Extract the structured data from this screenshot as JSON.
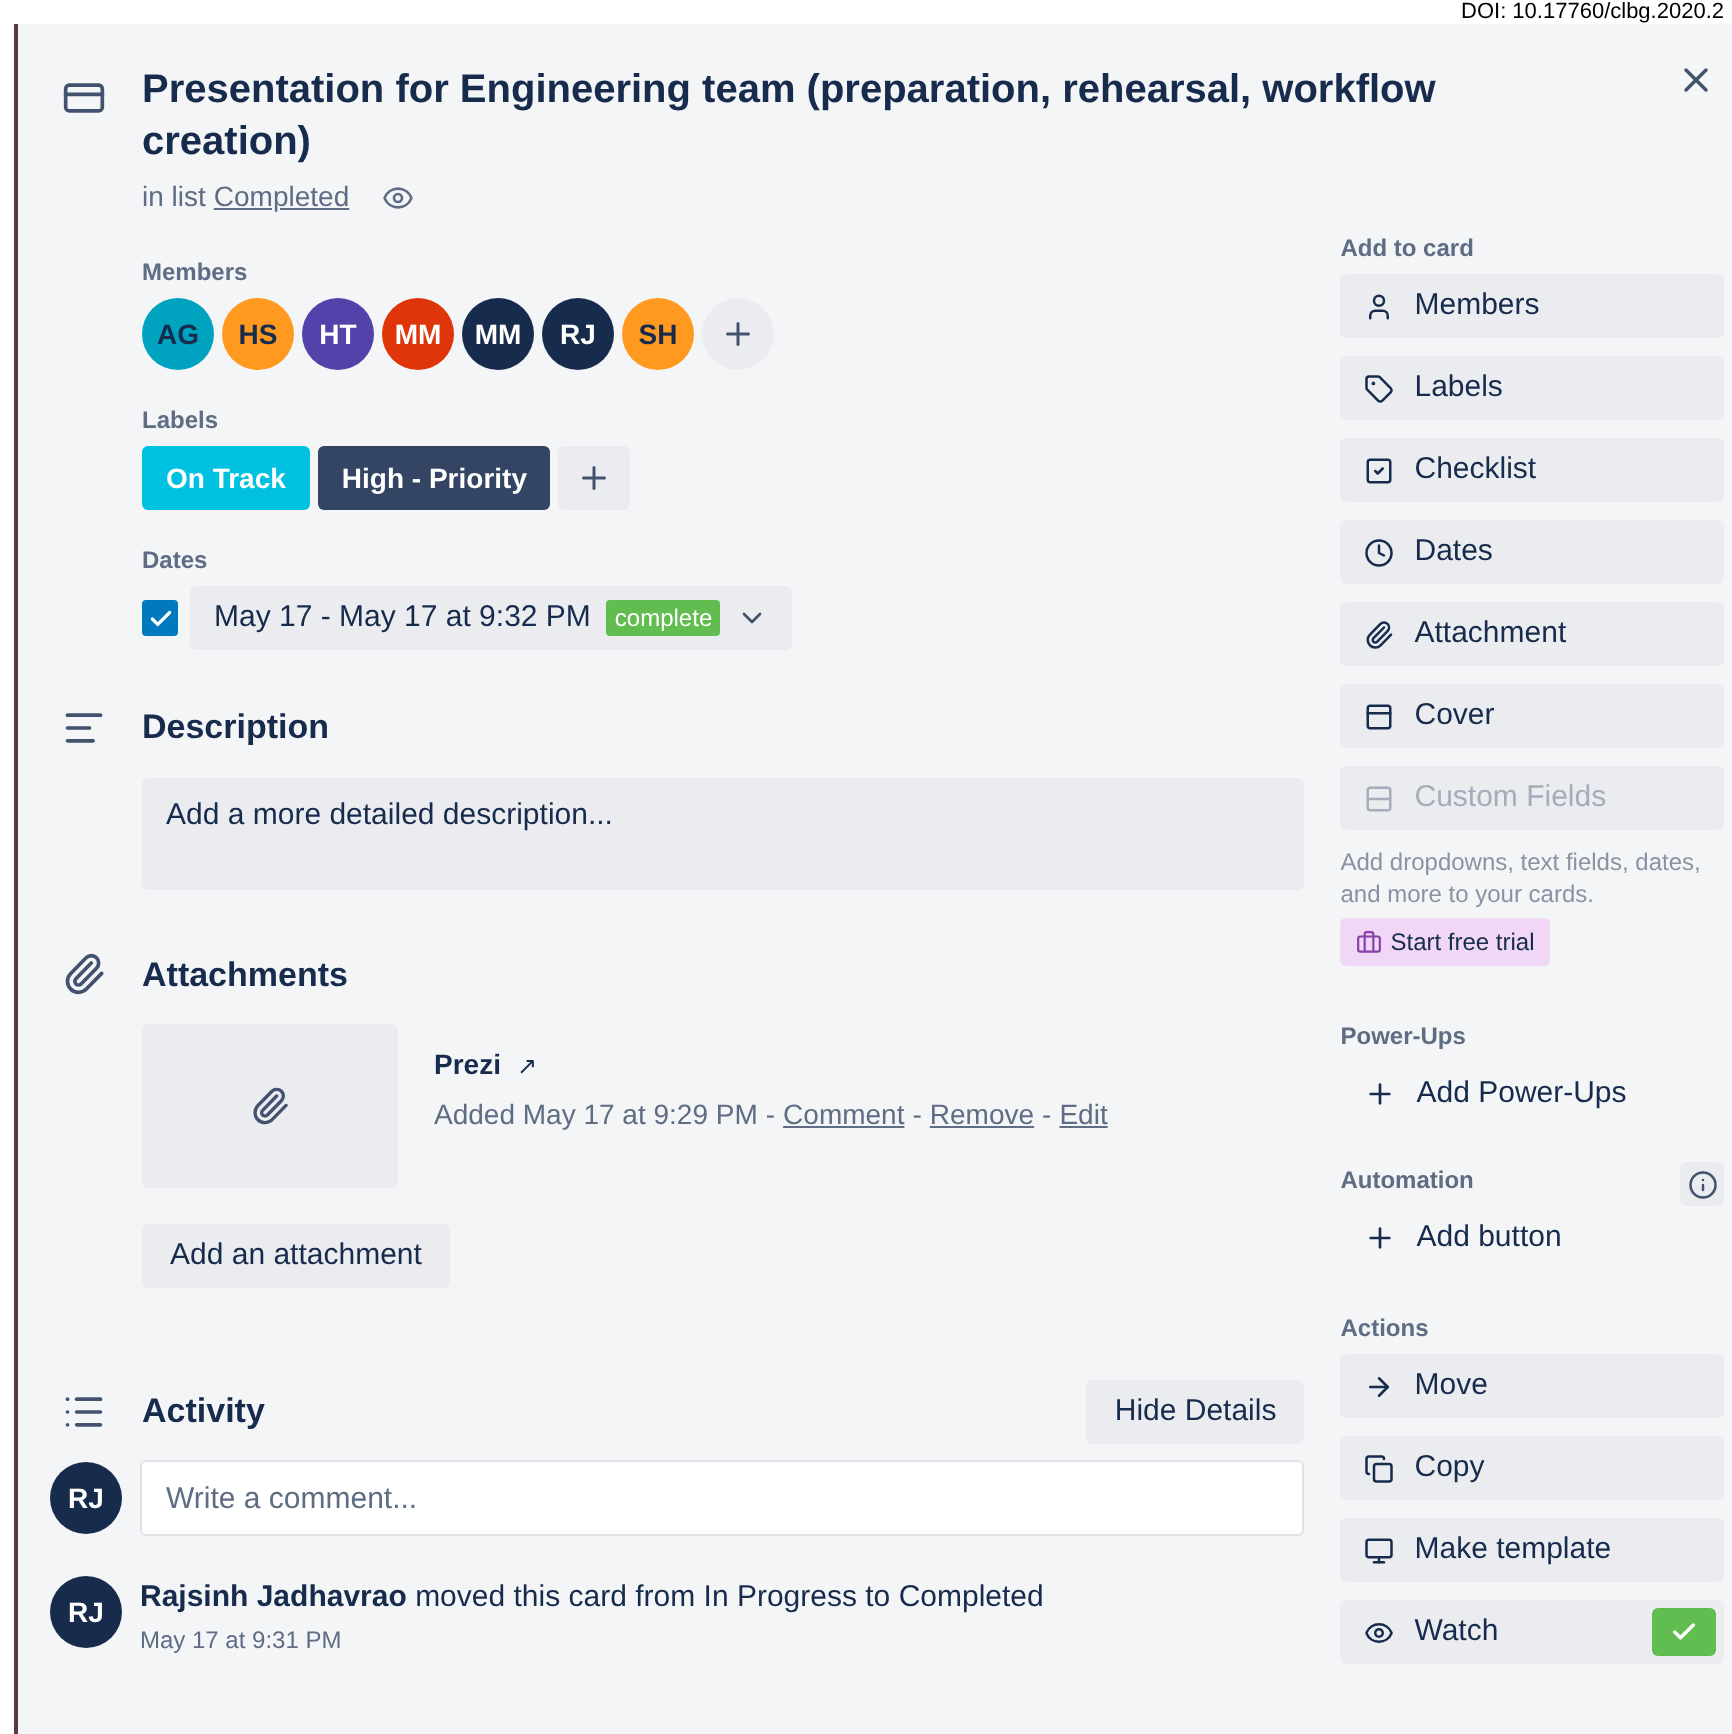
{
  "doi": "DOI: 10.17760/clbg.2020.2",
  "card": {
    "title": "Presentation for Engineering team (preparation, rehearsal, workflow creation)",
    "list_prefix": "in list",
    "list_name": "Completed"
  },
  "members": {
    "heading": "Members",
    "items": [
      {
        "initials": "AG",
        "color": "#00a3bf"
      },
      {
        "initials": "HS",
        "color": "#ff991f"
      },
      {
        "initials": "HT",
        "color": "#5243aa"
      },
      {
        "initials": "MM",
        "color": "#de350b"
      },
      {
        "initials": "MM",
        "color": "#172b4d"
      },
      {
        "initials": "RJ",
        "color": "#172b4d"
      },
      {
        "initials": "SH",
        "color": "#ff991f"
      }
    ]
  },
  "labels": {
    "heading": "Labels",
    "items": [
      {
        "text": "On Track",
        "color": "#00c2e0"
      },
      {
        "text": "High - Priority",
        "color": "#344563"
      }
    ]
  },
  "dates": {
    "heading": "Dates",
    "checked": true,
    "value": "May 17 - May 17 at 9:32 PM",
    "badge": "complete"
  },
  "description": {
    "heading": "Description",
    "placeholder": "Add a more detailed description..."
  },
  "attachments": {
    "heading": "Attachments",
    "items": [
      {
        "name": "Prezi",
        "link_mark": "↗",
        "added": "Added May 17 at 9:29 PM",
        "separator": "-",
        "actions": [
          "Comment",
          "Remove",
          "Edit"
        ]
      }
    ],
    "add_button": "Add an attachment"
  },
  "activity": {
    "heading": "Activity",
    "toggle_button": "Hide Details",
    "commenter_initials": "RJ",
    "comment_placeholder": "Write a comment...",
    "entries": [
      {
        "initials": "RJ",
        "author": "Rajsinh Jadhavrao",
        "text": "moved this card from In Progress to Completed",
        "time": "May 17 at 9:31 PM"
      }
    ]
  },
  "sidebar": {
    "add_to_card": {
      "heading": "Add to card",
      "items": [
        {
          "label": "Members",
          "disabled": false
        },
        {
          "label": "Labels",
          "disabled": false
        },
        {
          "label": "Checklist",
          "disabled": false
        },
        {
          "label": "Dates",
          "disabled": false
        },
        {
          "label": "Attachment",
          "disabled": false
        },
        {
          "label": "Cover",
          "disabled": false
        },
        {
          "label": "Custom Fields",
          "disabled": true
        }
      ],
      "note": "Add dropdowns, text fields, dates, and more to your cards.",
      "trial_button": "Start free trial"
    },
    "power_ups": {
      "heading": "Power-Ups",
      "button": "Add Power-Ups"
    },
    "automation": {
      "heading": "Automation",
      "button": "Add button"
    },
    "actions": {
      "heading": "Actions",
      "items": [
        {
          "label": "Move",
          "checked": false
        },
        {
          "label": "Copy",
          "checked": false
        },
        {
          "label": "Make template",
          "checked": false
        },
        {
          "label": "Watch",
          "checked": true
        }
      ]
    }
  }
}
